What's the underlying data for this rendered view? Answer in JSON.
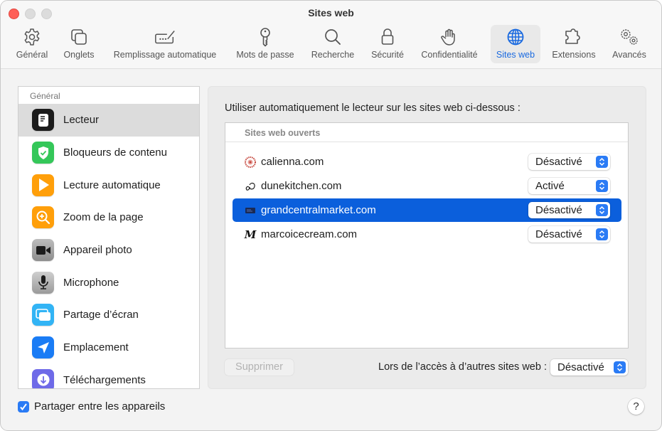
{
  "window": {
    "title": "Sites web"
  },
  "toolbar": {
    "items": [
      {
        "label": "Général",
        "icon": "gear-icon"
      },
      {
        "label": "Onglets",
        "icon": "tabs-icon"
      },
      {
        "label": "Remplissage automatique",
        "icon": "autofill-icon"
      },
      {
        "label": "Mots de passe",
        "icon": "key-icon"
      },
      {
        "label": "Recherche",
        "icon": "search-icon"
      },
      {
        "label": "Sécurité",
        "icon": "lock-icon"
      },
      {
        "label": "Confidentialité",
        "icon": "hand-icon"
      },
      {
        "label": "Sites web",
        "icon": "globe-icon",
        "active": true
      },
      {
        "label": "Extensions",
        "icon": "puzzle-icon"
      },
      {
        "label": "Avancés",
        "icon": "gears-icon"
      }
    ]
  },
  "sidebar": {
    "header": "Général",
    "items": [
      {
        "label": "Lecteur",
        "icon": "reader-icon",
        "color": "#1c1c1c",
        "selected": true
      },
      {
        "label": "Bloqueurs de contenu",
        "icon": "shield-check-icon",
        "color": "#34c759"
      },
      {
        "label": "Lecture automatique",
        "icon": "play-icon",
        "color": "#ff9f0a"
      },
      {
        "label": "Zoom de la page",
        "icon": "zoom-icon",
        "color": "#ff9f0a"
      },
      {
        "label": "Appareil photo",
        "icon": "camera-icon",
        "color": "#9a9a9a"
      },
      {
        "label": "Microphone",
        "icon": "microphone-icon",
        "color": "#9a9a9a"
      },
      {
        "label": "Partage d’écran",
        "icon": "screen-share-icon",
        "color": "#32b4f5"
      },
      {
        "label": "Emplacement",
        "icon": "location-icon",
        "color": "#1a7cf5"
      },
      {
        "label": "Téléchargements",
        "icon": "download-icon",
        "color": "#6e6ae8"
      }
    ]
  },
  "panel": {
    "title": "Utiliser automatiquement le lecteur sur les sites web ci-dessous :",
    "table_header": "Sites web ouverts",
    "sites": [
      {
        "name": "calienna.com",
        "setting": "Désactivé"
      },
      {
        "name": "dunekitchen.com",
        "setting": "Activé"
      },
      {
        "name": "grandcentralmarket.com",
        "setting": "Désactivé",
        "selected": true
      },
      {
        "name": "marcoicecream.com",
        "setting": "Désactivé"
      }
    ],
    "delete_label": "Supprimer",
    "other_sites_label": "Lors de l’accès à d’autres sites web :",
    "other_sites_value": "Désactivé"
  },
  "footer": {
    "share_label": "Partager entre les appareils",
    "share_checked": true,
    "help_label": "?"
  },
  "colors": {
    "accent": "#0b5fdc",
    "close": "#fe5f57"
  }
}
